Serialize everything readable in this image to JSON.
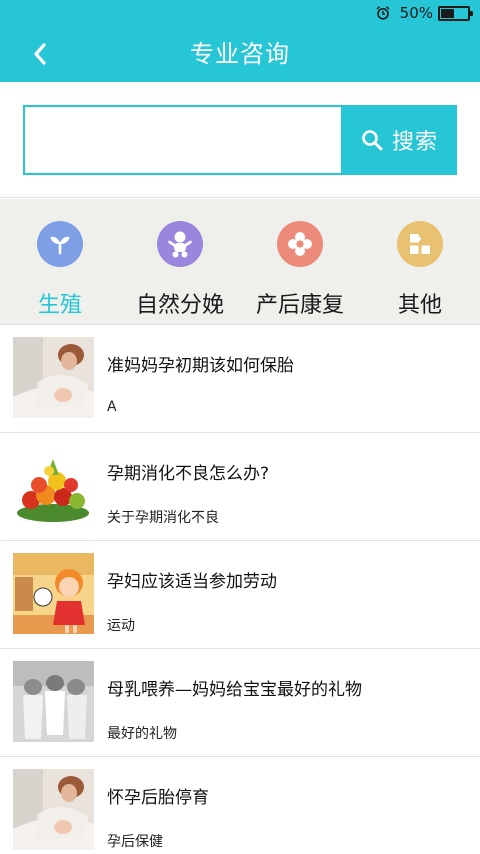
{
  "status_bar": {
    "battery_text": "50%",
    "battery_level": 0.5
  },
  "nav": {
    "title": "专业咨询"
  },
  "search": {
    "input_value": "",
    "button_label": "搜索"
  },
  "categories": [
    {
      "label": "生殖",
      "icon": "sprout-icon",
      "color": "#7e9ee6",
      "active": true
    },
    {
      "label": "自然分娩",
      "icon": "baby-icon",
      "color": "#9a86dc",
      "active": false
    },
    {
      "label": "产后康复",
      "icon": "flower-icon",
      "color": "#ec8a7a",
      "active": false
    },
    {
      "label": "其他",
      "icon": "apps-grid-icon",
      "color": "#e8c270",
      "active": false
    }
  ],
  "articles": [
    {
      "title": "准妈妈孕初期该如何保胎",
      "desc": "A",
      "thumb": "mother-baby-photo"
    },
    {
      "title": "孕期消化不良怎么办?",
      "desc": "关于孕期消化不良",
      "thumb": "fruits-vegetables-photo"
    },
    {
      "title": "孕妇应该适当参加劳动",
      "desc": "运动",
      "thumb": "cartoon-girl-illustration"
    },
    {
      "title": "母乳喂养—妈妈给宝宝最好的礼物",
      "desc": "最好的礼物",
      "thumb": "sleeping-babies-photo"
    },
    {
      "title": "怀孕后胎停育",
      "desc": "孕后保健",
      "thumb": "mother-baby-photo"
    }
  ],
  "colors": {
    "accent": "#26c6d6",
    "category_bg": "#efefec"
  }
}
